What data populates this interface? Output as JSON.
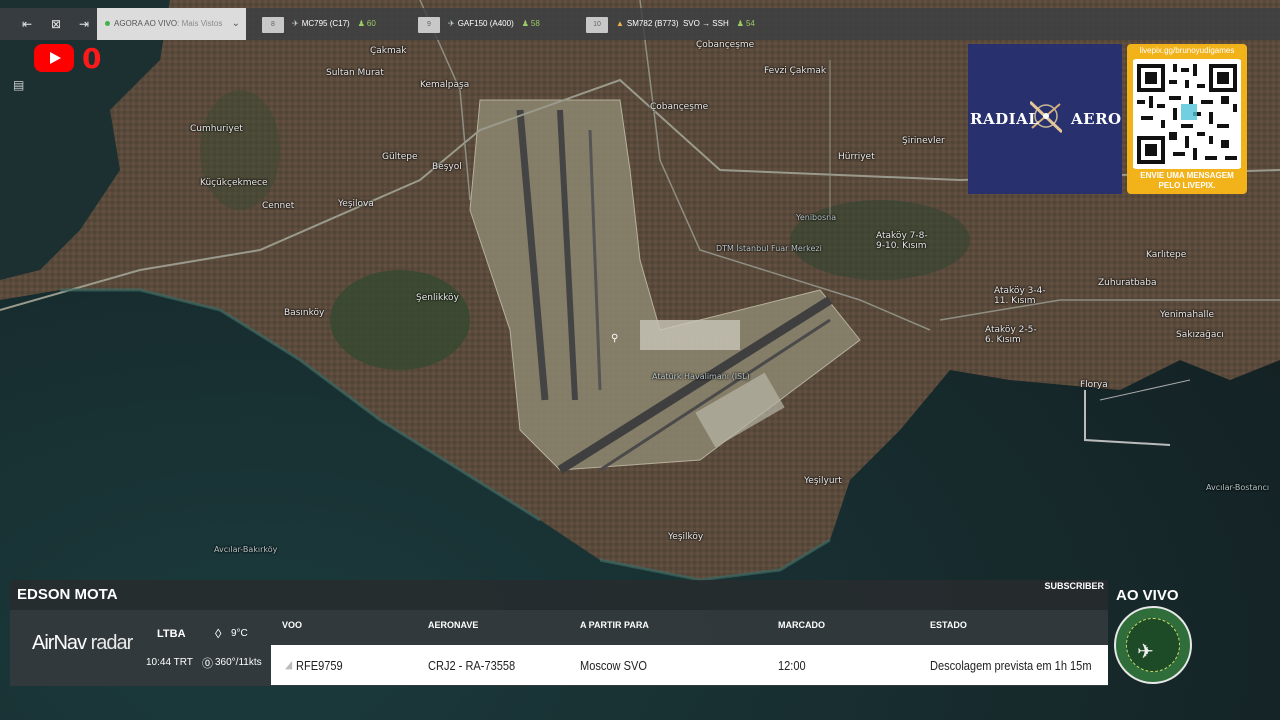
{
  "topbar": {
    "filter_label": "AGORA AO VIVO",
    "filter_sub": "Mais Vistos",
    "slots": [
      {
        "rank": "8",
        "flight": "MC795 (C17)",
        "count": "60"
      },
      {
        "rank": "9",
        "flight": "GAF150 (A400)",
        "count": "58"
      },
      {
        "rank": "10",
        "flight": "SM782 (B773)",
        "route": "SVO → SSH",
        "count": "54"
      }
    ]
  },
  "youtube": {
    "count": "0"
  },
  "ads": {
    "radial_left": "RADIAL",
    "radial_right": "AERO",
    "qr_url": "livepix.gg/brunoyudigames",
    "qr_msg_1": "ENVIE UMA MENSAGEM",
    "qr_msg_2": "PELO LIVEPIX."
  },
  "map_labels": [
    "Çobançeşme",
    "Fevzi Çakmak",
    "Çakmak",
    "Sultan Murat",
    "Kemalpaşa",
    "Çobançeşme",
    "Hürriyet",
    "Şirinevler",
    "Cumhuriyet",
    "Gültepe",
    "Beşyol",
    "Küçükçekmece",
    "Cennet",
    "Yeşilova",
    "Yenibosna",
    "Ataköy 7-8-9-10. Kısım",
    "Karlıtepe",
    "Zuhuratbaba",
    "Ataköy 3-4-11. Kısım",
    "Yenimahalle",
    "Ataköy 2-5-6. Kısım",
    "Sakızağacı",
    "Şenlikköy",
    "Basınköy",
    "Florya",
    "Yeşilyurt",
    "Yeşilköy",
    "Avcılar-Bakırköy",
    "Avcılar-Bostancı",
    "Atatürk Havalimanı (ISL)",
    "DTM İstanbul Fuar Merkezi"
  ],
  "panel": {
    "streamer": "EDSON MOTA",
    "subscriber": "SUBSCRIBER",
    "logo_a": "AirNav",
    "logo_b": "radar",
    "airport": "LTBA",
    "time": "10:44 TRT",
    "temp": "9°C",
    "wind": "360°/11kts",
    "headers": {
      "voo": "VOO",
      "aeronave": "AERONAVE",
      "apartir": "A PARTIR PARA",
      "marcado": "MARCADO",
      "estado": "ESTADO"
    },
    "flight": {
      "voo": "RFE9759",
      "aeronave": "CRJ2 - RA-73558",
      "apartir": "Moscow SVO",
      "marcado": "12:00",
      "estado": "Descolagem prevista em 1h 15m"
    }
  },
  "live": {
    "label": "AO VIVO"
  },
  "colors": {
    "accent_green": "#9ccc65",
    "youtube_red": "#ff0000",
    "panel_bg": "#343a3d",
    "radial_bg": "#28306e",
    "livepix": "#f2b21a"
  }
}
